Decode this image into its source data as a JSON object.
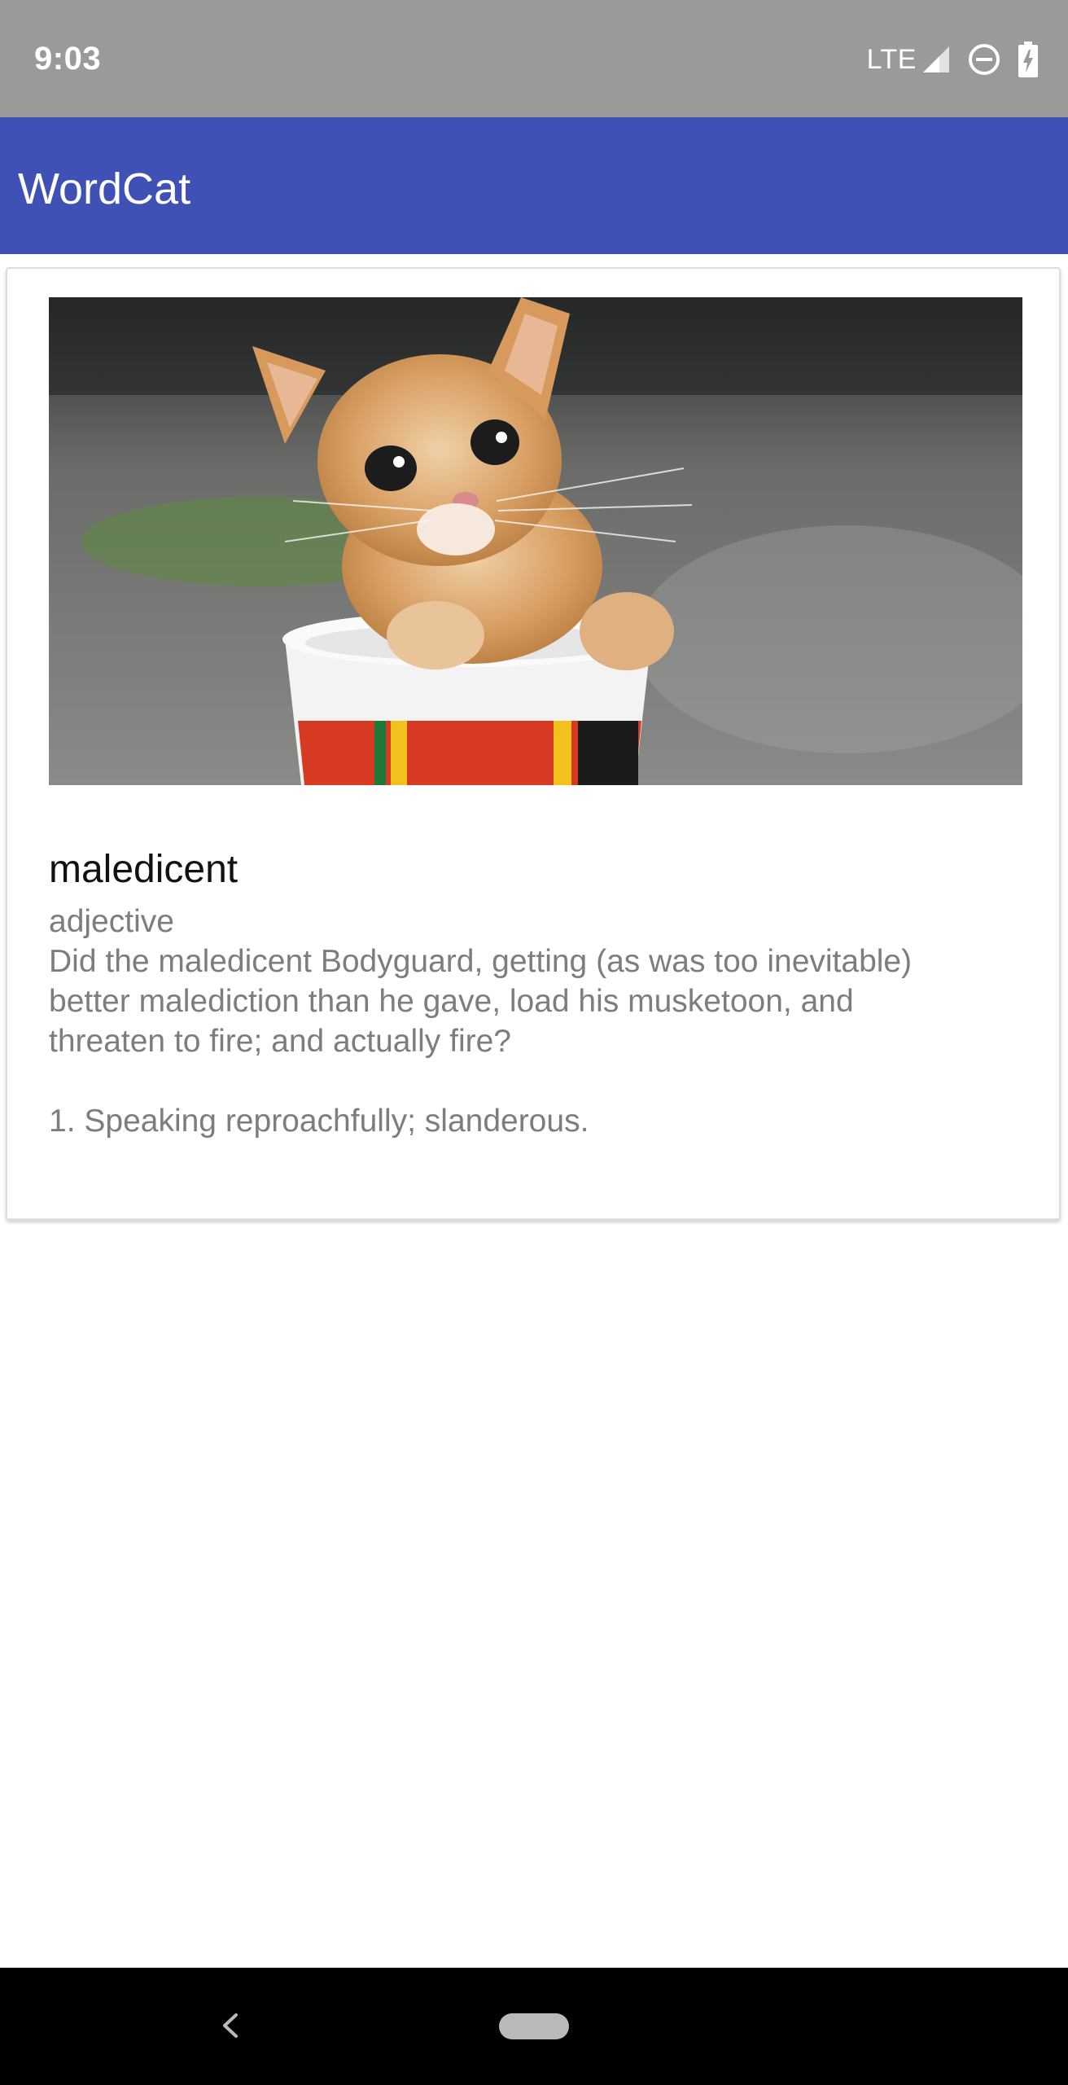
{
  "status_bar": {
    "time": "9:03",
    "network": "LTE",
    "icons": [
      "signal-icon",
      "do-not-disturb-icon",
      "battery-charging-icon"
    ]
  },
  "app_bar": {
    "title": "WordCat",
    "color": "#3f51b5"
  },
  "card": {
    "image": "kitten-in-cup-photo",
    "word": "maledicent",
    "part_of_speech": "adjective",
    "example": "Did the maledicent Bodyguard, getting (as was too inevitable) better malediction than he gave, load his musketoon, and threaten to fire; and actually fire?",
    "definition": "1. Speaking reproachfully; slanderous."
  },
  "nav_bar": {
    "icons": [
      "back-icon",
      "home-pill-icon"
    ]
  }
}
